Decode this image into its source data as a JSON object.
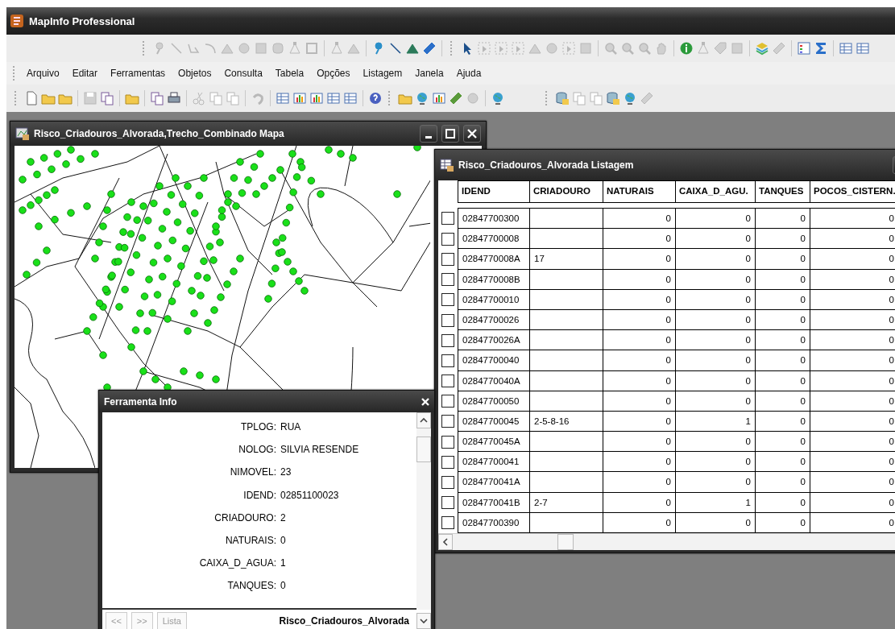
{
  "app": {
    "title": "MapInfo Professional"
  },
  "menu": [
    "Arquivo",
    "Editar",
    "Ferramentas",
    "Objetos",
    "Consulta",
    "Tabela",
    "Opções",
    "Listagem",
    "Janela",
    "Ajuda"
  ],
  "map_window": {
    "title": "Risco_Criadouros_Alvorada,Trecho_Combinado Mapa"
  },
  "table_window": {
    "title": "Risco_Criadouros_Alvorada Listagem",
    "columns": [
      "IDEND",
      "CRIADOURO",
      "NATURAIS",
      "CAIXA_D_AGU.",
      "TANQUES",
      "POCOS_CISTERN."
    ],
    "rows": [
      {
        "checked": false,
        "cells": [
          "02847700300",
          null,
          "0",
          "0",
          "0",
          "0"
        ]
      },
      {
        "checked": false,
        "cells": [
          "02847700008",
          null,
          "0",
          "0",
          "0",
          "0"
        ]
      },
      {
        "checked": false,
        "cells": [
          "0284770008A",
          "17",
          "0",
          "0",
          "0",
          "0"
        ]
      },
      {
        "checked": false,
        "cells": [
          "0284770008B",
          null,
          "0",
          "0",
          "0",
          "0"
        ]
      },
      {
        "checked": false,
        "cells": [
          "02847700010",
          null,
          "0",
          "0",
          "0",
          "0"
        ]
      },
      {
        "checked": false,
        "cells": [
          "02847700026",
          null,
          "0",
          "0",
          "0",
          "0"
        ]
      },
      {
        "checked": false,
        "cells": [
          "0284770026A",
          null,
          "0",
          "0",
          "0",
          "0"
        ]
      },
      {
        "checked": false,
        "cells": [
          "02847700040",
          null,
          "0",
          "0",
          "0",
          "0"
        ]
      },
      {
        "checked": false,
        "cells": [
          "0284770040A",
          null,
          "0",
          "0",
          "0",
          "0"
        ]
      },
      {
        "checked": false,
        "cells": [
          "02847700050",
          null,
          "0",
          "0",
          "0",
          "0"
        ]
      },
      {
        "checked": false,
        "cells": [
          "02847700045",
          "2-5-8-16",
          "0",
          "1",
          "0",
          "0"
        ]
      },
      {
        "checked": false,
        "cells": [
          "0284770045A",
          null,
          "0",
          "0",
          "0",
          "0"
        ]
      },
      {
        "checked": false,
        "cells": [
          "02847700041",
          null,
          "0",
          "0",
          "0",
          "0"
        ]
      },
      {
        "checked": false,
        "cells": [
          "0284770041A",
          null,
          "0",
          "0",
          "0",
          "0"
        ]
      },
      {
        "checked": false,
        "cells": [
          "0284770041B",
          "2-7",
          "0",
          "1",
          "0",
          "0"
        ]
      },
      {
        "checked": false,
        "cells": [
          "02847700390",
          null,
          "0",
          "0",
          "0",
          "0"
        ]
      }
    ]
  },
  "info_window": {
    "title": "Ferramenta Info",
    "fields": [
      {
        "label": "TPLOG:",
        "value": "RUA"
      },
      {
        "label": "NOLOG:",
        "value": "SILVIA RESENDE"
      },
      {
        "label": "NIMOVEL:",
        "value": "23"
      },
      {
        "label": "IDEND:",
        "value": "02851100023"
      },
      {
        "label": "CRIADOURO:",
        "value": "2"
      },
      {
        "label": "NATURAIS:",
        "value": "0"
      },
      {
        "label": "CAIXA_D_AGUA:",
        "value": "1"
      },
      {
        "label": "TANQUES:",
        "value": "0"
      }
    ],
    "buttons": [
      {
        "label": "<<",
        "disabled": true
      },
      {
        "label": ">>",
        "disabled": true
      },
      {
        "label": "Lista",
        "disabled": true
      }
    ],
    "table_name": "Risco_Criadouros_Alvorada"
  }
}
